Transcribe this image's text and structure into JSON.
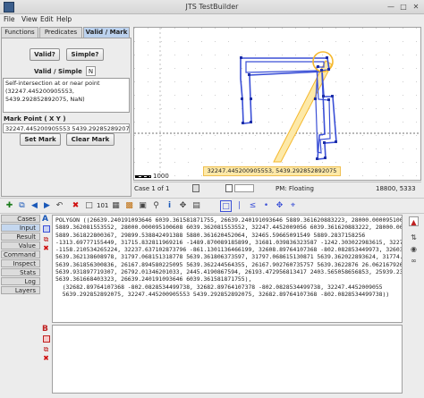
{
  "window": {
    "title": "JTS TestBuilder"
  },
  "menu": [
    "File",
    "View",
    "Edit",
    "Help"
  ],
  "left_tabs": [
    "Functions",
    "Predicates",
    "Valid / Mark"
  ],
  "valid_panel": {
    "valid_button": "Valid?",
    "simple_button": "Simple?",
    "result_label": "Valid / Simple",
    "result_value": "N",
    "message": "Self-intersection at or near point (32247.445200905553, 5439.292852892075, NaN)",
    "mark_point_label": "Mark Point ( X Y )",
    "mark_point_value": "32247.445200905553 5439.292852892075",
    "set_mark_button": "Set Mark",
    "clear_mark_button": "Clear Mark"
  },
  "canvas": {
    "tooltip": "32247.445200905553, 5439.292852892075",
    "scale_label": "1000",
    "accent_color": "#3a4fd6",
    "highlight_color": "#f5b82e"
  },
  "status": {
    "case_label": "Case 1 of 1",
    "precision_model": "PM: Floating",
    "coords": "18800, 5333"
  },
  "side_tabs": [
    "Cases",
    "Input",
    "Result",
    "Value",
    "Command",
    "Inspect",
    "Stats",
    "Log",
    "Layers"
  ],
  "geometry": {
    "a_label": "A",
    "b_label": "B",
    "wkt_lines": [
      "POLYGON ((26639.240191093646 6039.361581871755, 26639.240191093646 5889.361620883223, 28000.000095100608",
      "5889.362081553552, 28000.000095100608 6039.362081553552, 32247.4452009056 6039.361620883222, 28000.000931001",
      "5889.361822800367, 29899.538842491388 5880.361620452064, 32465.59665091549 5889.2837158256",
      "-1313.69777155449, 31715.832811969216 -1489.870089185899, 31681.039836323587 -1242.303022983615, 32279.38903311618",
      "-1158.210534265224, 32237.637102873796 -861.1301136466199, 32608.89764107368 -802.082853449973, 32603.89764107368",
      "5639.362138608978, 31797.068151318778 5639.361806373597, 31797.068615130871 5639.362022893624, 31774.37829",
      "5639.361856300836, 26167.894580225095 5639.362244564355, 26167.902760735757 5639.3622876 26.062167926924",
      "5639.931897719307, 26792.01346201033, 2445.4190867594, 26193.472956813417 2403.565058656853, 25939.238114175267",
      "5639.361668403323, 26639.240191093646 6039.361581871755),",
      "  (32682.89764107368 -802.0828534499738, 32682.89764107378 -802.0828534499738, 32247.4452009055",
      "  5639.292852892075, 32247.445200905553 5439.292852892075, 32682.89764107368 -802.0828534499738))"
    ]
  },
  "icons": {
    "toolbar": [
      "add-case-icon",
      "copy-icon",
      "prev-icon",
      "next-icon",
      "undo-icon",
      "delete-icon",
      "clear-icon",
      "precision-icon",
      "view-icon",
      "extract-icon",
      "info-icon",
      "zoom-icon",
      "pan-icon",
      "draw-polygon-icon",
      "draw-linestring-icon",
      "draw-point-icon",
      "edit-icon",
      "move-icon",
      "grid-icon"
    ]
  }
}
